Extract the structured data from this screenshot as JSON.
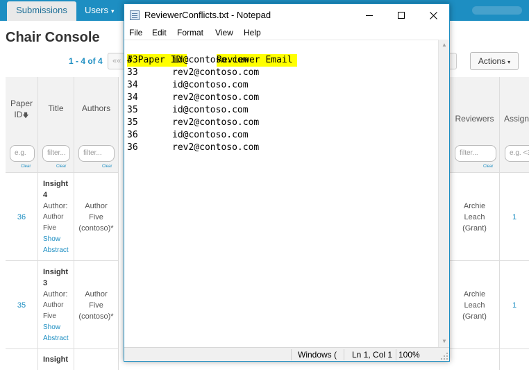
{
  "nav": {
    "submissions_label": "Submissions",
    "users_label": "Users",
    "users_caret": "▾"
  },
  "page": {
    "title": "Chair Console",
    "pager_text": "1 - 4 of 4",
    "first_page_glyph": "««",
    "actions_label": "Actions",
    "actions_caret": "▾"
  },
  "table": {
    "columns": {
      "paper_id": "Paper ID",
      "paper_id_sort_icon": "🡇",
      "title": "Title",
      "authors": "Authors",
      "reviewers": "Reviewers",
      "assign": "Assign"
    },
    "filters": {
      "paper_id_placeholder": "e.g. ",
      "title_placeholder": "filter...",
      "authors_placeholder": "filter...",
      "reviewers_placeholder": "filter...",
      "assign_placeholder": "e.g. <3"
    },
    "clear_label": "Clear",
    "rows": [
      {
        "paper_id": "36",
        "title": [
          "Insight",
          "4"
        ],
        "author_prefix": [
          "Author:",
          "Author",
          "Five"
        ],
        "show_abstract": [
          "Show",
          "Abstract"
        ],
        "authors": [
          "Author",
          "Five",
          "(contoso)*"
        ],
        "reviewers": [
          "Archie",
          "Leach",
          "(Grant)"
        ],
        "assign": "1"
      },
      {
        "paper_id": "35",
        "title": [
          "Insight",
          "3"
        ],
        "author_prefix": [
          "Author:",
          "Author",
          "Five"
        ],
        "show_abstract": [
          "Show",
          "Abstract"
        ],
        "authors": [
          "Author",
          "Five",
          "(contoso)*"
        ],
        "reviewers": [
          "Archie",
          "Leach",
          "(Grant)"
        ],
        "assign": "1"
      },
      {
        "title": [
          "Insight"
        ]
      }
    ]
  },
  "notepad": {
    "window_title": "ReviewerConflicts.txt - Notepad",
    "menu": [
      "File",
      "Edit",
      "Format",
      "View",
      "Help"
    ],
    "header_line": {
      "col1": "# Paper ID",
      "col2": "Reviewer Email"
    },
    "lines": [
      {
        "id": "33",
        "email": "id@contoso.com"
      },
      {
        "id": "33",
        "email": "rev2@contoso.com"
      },
      {
        "id": "34",
        "email": "id@contoso.com"
      },
      {
        "id": "34",
        "email": "rev2@contoso.com"
      },
      {
        "id": "35",
        "email": "id@contoso.com"
      },
      {
        "id": "35",
        "email": "rev2@contoso.com"
      },
      {
        "id": "36",
        "email": "id@contoso.com"
      },
      {
        "id": "36",
        "email": "rev2@contoso.com"
      }
    ],
    "status": {
      "line_ending": "Windows (",
      "position": "Ln 1, Col 1",
      "zoom": "100%"
    },
    "highlight_color": "#ffff00"
  }
}
